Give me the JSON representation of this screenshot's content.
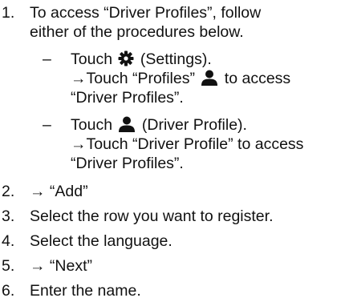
{
  "steps": [
    {
      "number": "1.",
      "lines": [
        "To access “Driver Profiles”, follow",
        "either of the procedures below."
      ],
      "substeps": [
        {
          "dash": "–",
          "line1_pre": "Touch ",
          "line1_post": " (Settings).",
          "line1_icon": "gear-icon",
          "line2_pre": "→Touch “Profiles” ",
          "line2_post": " to access",
          "line2_icon": "person-icon",
          "line3": "“Driver Profiles”."
        },
        {
          "dash": "–",
          "line1_pre": "Touch ",
          "line1_post": " (Driver Profile).",
          "line1_icon": "person-icon",
          "line2": "→Touch “Driver Profile” to access",
          "line3": "“Driver Profiles”."
        }
      ]
    },
    {
      "number": "2.",
      "text": "→ “Add”"
    },
    {
      "number": "3.",
      "text": "Select the row you want to register."
    },
    {
      "number": "4.",
      "text": "Select the language."
    },
    {
      "number": "5.",
      "text": "→ “Next”"
    },
    {
      "number": "6.",
      "text": "Enter the name."
    }
  ]
}
